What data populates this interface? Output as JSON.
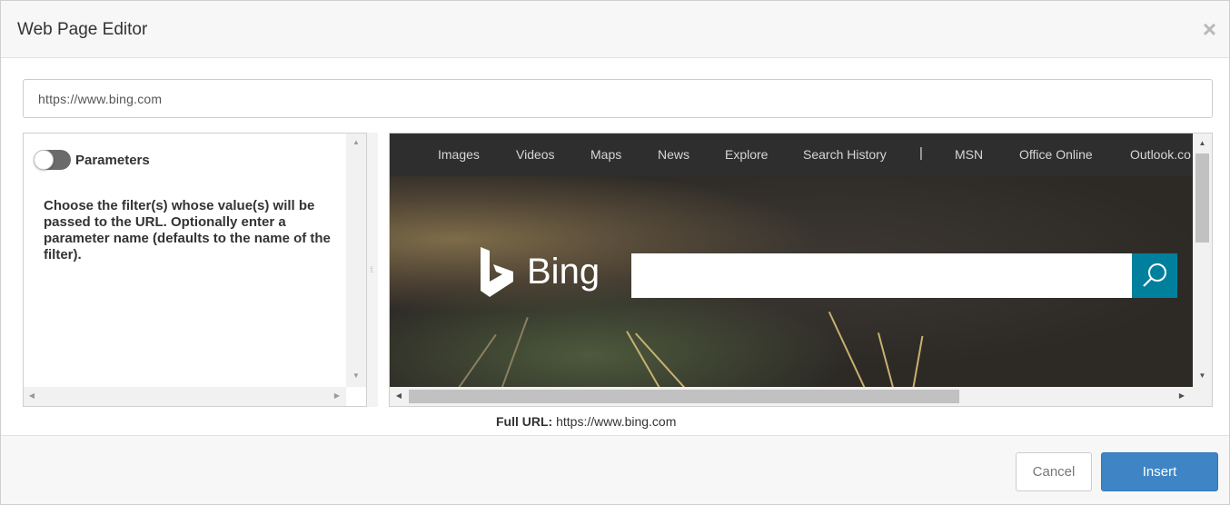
{
  "dialog": {
    "title": "Web Page Editor",
    "close_icon": "close-icon"
  },
  "url_input": {
    "value": "https://www.bing.com"
  },
  "parameters": {
    "toggle_on": false,
    "label": "Parameters",
    "description": "Choose the filter(s) whose value(s) will be passed to the URL. Optionally enter a parameter name (defaults to the name of the filter)."
  },
  "preview": {
    "nav_items": [
      "Images",
      "Videos",
      "Maps",
      "News",
      "Explore",
      "Search History",
      "MSN",
      "Office Online",
      "Outlook.co"
    ],
    "nav_separator": "|",
    "brand": "Bing",
    "search_value": "",
    "icons": {
      "logo": "bing-logo-icon",
      "search": "search-icon"
    },
    "colors": {
      "nav_bg": "#2e2e2e",
      "search_button": "#00809d"
    }
  },
  "full_url": {
    "label": "Full URL:",
    "value": "https://www.bing.com"
  },
  "footer": {
    "cancel_label": "Cancel",
    "insert_label": "Insert",
    "insert_color": "#3f85c6"
  }
}
